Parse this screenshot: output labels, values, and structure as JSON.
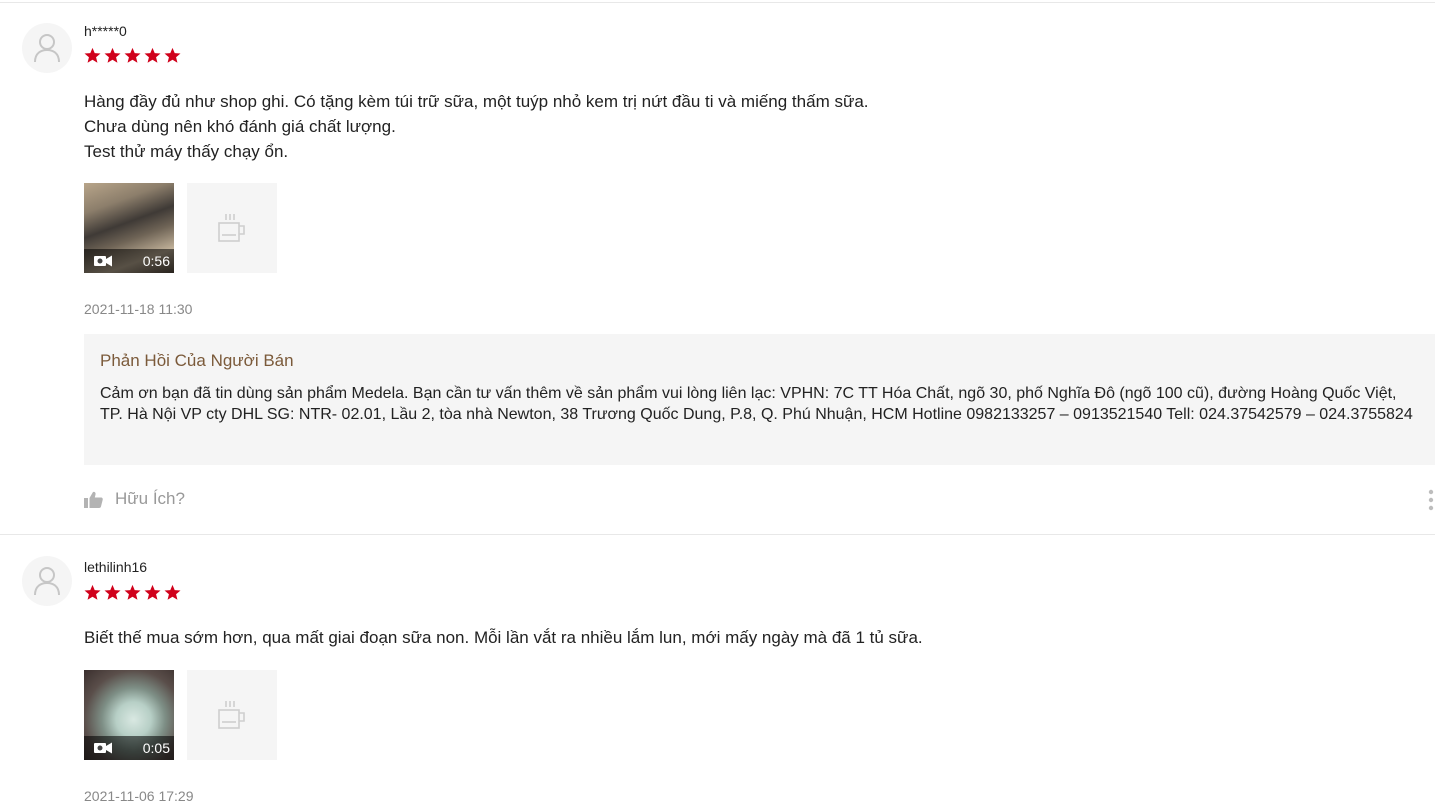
{
  "reviews": [
    {
      "username": "h*****0",
      "rating": 5,
      "content_lines": [
        "Hàng đầy đủ như shop ghi. Có tặng kèm túi trữ sữa, một tuýp nhỏ kem trị nứt đầu ti và miếng thấm sữa.",
        "Chưa dùng nên khó đánh giá chất lượng.",
        "Test thử máy thấy chạy ổn."
      ],
      "video_duration": "0:56",
      "timestamp": "2021-11-18 11:30",
      "seller_reply": {
        "title": "Phản Hồi Của Người Bán",
        "text": "Cảm ơn bạn đã tin dùng sản phẩm Medela. Bạn cần tư vấn thêm về sản phẩm vui lòng liên lạc: VPHN: 7C TT Hóa Chất, ngõ 30, phố Nghĩa Đô (ngõ 100 cũ), đường Hoàng Quốc Việt, TP. Hà Nội VP cty DHL SG: NTR- 02.01, Lầu 2, tòa nhà Newton, 38 Trương Quốc Dung, P.8, Q. Phú Nhuận, HCM Hotline 0982133257 – 0913521540 Tell: 024.37542579 – 024.3755824"
      },
      "helpful_label": "Hữu Ích?"
    },
    {
      "username": "lethilinh16",
      "rating": 5,
      "content_lines": [
        "Biết thế mua sớm hơn, qua mất giai đoạn sữa non. Mỗi lần vắt ra nhiều lắm lun, mới mấy ngày mà đã 1 tủ sữa."
      ],
      "video_duration": "0:05",
      "timestamp": "2021-11-06 17:29"
    }
  ],
  "colors": {
    "star": "#d0011b",
    "seller_title": "#7b5a3a",
    "muted": "#888888"
  },
  "icons": {
    "avatar": "user-icon",
    "star": "star-icon",
    "video": "video-camera-icon",
    "placeholder": "coffee-cup-icon",
    "helpful": "thumbs-up-icon",
    "more": "more-vertical-icon"
  }
}
